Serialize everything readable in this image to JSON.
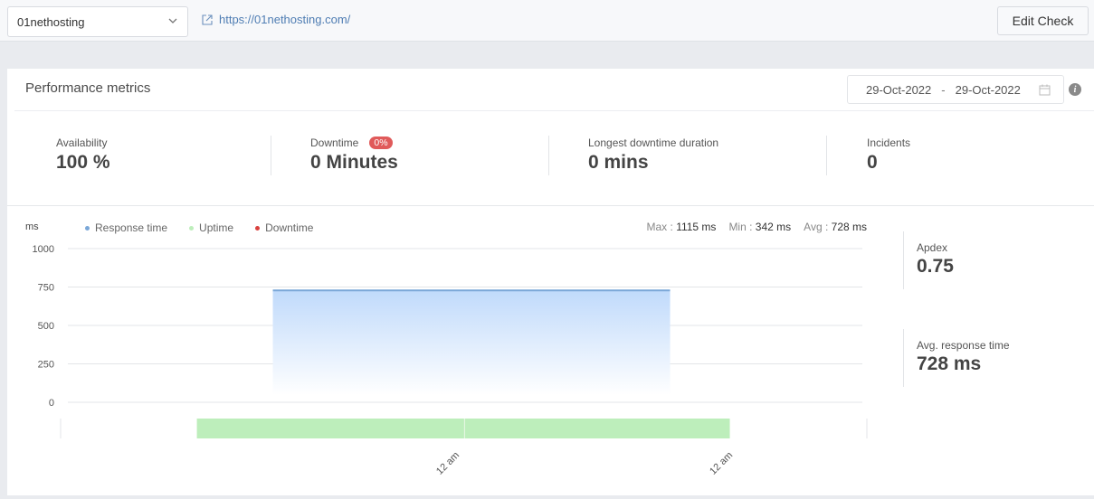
{
  "topbar": {
    "site_select_value": "01nethosting",
    "url": "https://01nethosting.com/",
    "edit_button": "Edit Check"
  },
  "panel": {
    "title": "Performance metrics",
    "date_from": "29-Oct-2022",
    "date_sep": "-",
    "date_to": "29-Oct-2022",
    "info_glyph": "i"
  },
  "stats": {
    "availability": {
      "label": "Availability",
      "value": "100 %"
    },
    "downtime": {
      "label": "Downtime",
      "badge": "0%",
      "value": "0 Minutes"
    },
    "longest": {
      "label": "Longest downtime duration",
      "value": "0 mins"
    },
    "incidents": {
      "label": "Incidents",
      "value": "0"
    }
  },
  "side_stats": {
    "apdex": {
      "label": "Apdex",
      "value": "0.75"
    },
    "avg_response": {
      "label": "Avg. response time",
      "value": "728 ms"
    }
  },
  "colors": {
    "response": "#7aa7d8",
    "uptime": "#bdeebb",
    "downtime": "#d9413e",
    "badge": "#e05a5a",
    "link": "#4f7db3"
  },
  "chart_data": {
    "type": "area",
    "ylabel": "ms",
    "yticks": [
      "1000",
      "750",
      "500",
      "250",
      "0"
    ],
    "ytick_values": [
      1000,
      750,
      500,
      250,
      0
    ],
    "ylim": [
      0,
      1000
    ],
    "grid": true,
    "legend": [
      "Response time",
      "Uptime",
      "Downtime"
    ],
    "legend_position": "top-left",
    "summary": {
      "max_label": "Max :",
      "max": "1115 ms",
      "min_label": "Min :",
      "min": "342 ms",
      "avg_label": "Avg :",
      "avg": "728 ms"
    },
    "series": [
      {
        "name": "Response time",
        "x_start_frac": 0.258,
        "x_end_frac": 0.758,
        "value": 728
      }
    ],
    "uptime_bar": {
      "start_frac": 0.169,
      "end_frac": 0.83,
      "split_frac": 0.501
    },
    "xticks": [
      {
        "label": "12 am",
        "frac": 0.495
      },
      {
        "label": "12 am",
        "frac": 0.834
      }
    ]
  }
}
